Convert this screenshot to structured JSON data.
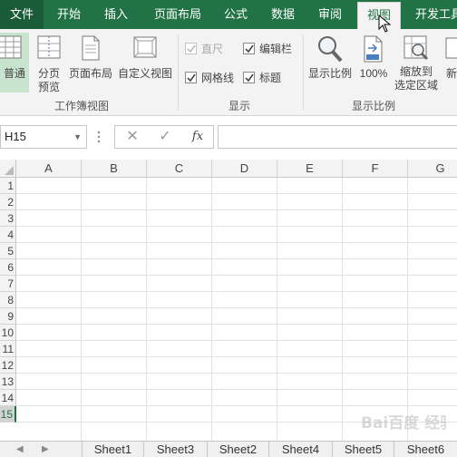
{
  "tabs": [
    {
      "label": "文件"
    },
    {
      "label": "开始"
    },
    {
      "label": "插入"
    },
    {
      "label": "页面布局"
    },
    {
      "label": "公式"
    },
    {
      "label": "数据"
    },
    {
      "label": "审阅"
    },
    {
      "label": "视图"
    },
    {
      "label": "开发工具"
    }
  ],
  "active_tab": "视图",
  "ribbon": {
    "workbook_views": {
      "label": "工作簿视图",
      "buttons": [
        {
          "label": "普通",
          "pressed": true
        },
        {
          "label1": "分页",
          "label2": "预览"
        },
        {
          "label": "页面布局"
        },
        {
          "label": "自定义视图"
        }
      ]
    },
    "show": {
      "label": "显示",
      "checkboxes": [
        {
          "label": "直尺",
          "checked": true,
          "disabled": true
        },
        {
          "label": "编辑栏",
          "checked": true
        },
        {
          "label": "网格线",
          "checked": true
        },
        {
          "label": "标题",
          "checked": true
        }
      ]
    },
    "zoom": {
      "label": "显示比例",
      "buttons": [
        {
          "label": "显示比例"
        },
        {
          "label": "100%"
        },
        {
          "label1": "缩放到",
          "label2": "选定区域"
        },
        {
          "label": "新"
        }
      ]
    }
  },
  "formula_bar": {
    "name_box": "H15",
    "cancel_glyph": "✕",
    "enter_glyph": "✓",
    "fx_label": "fx",
    "formula": ""
  },
  "grid": {
    "columns": [
      "A",
      "B",
      "C",
      "D",
      "E",
      "F",
      "G"
    ],
    "rows": [
      "1",
      "2",
      "3",
      "4",
      "5",
      "6",
      "7",
      "8",
      "9",
      "10",
      "11",
      "12",
      "13",
      "14",
      "15"
    ],
    "selected_row": "15"
  },
  "sheets": [
    "Sheet1",
    "Sheet3",
    "Sheet2",
    "Sheet4",
    "Sheet5",
    "Sheet6"
  ],
  "sheet_nav": {
    "prev": "◀",
    "next": "▶"
  },
  "colors": {
    "accent": "#217346",
    "ribbon_bg": "#f3f3f3",
    "pressed": "#c8e4cf"
  },
  "watermark": {
    "text": "Bai百度 经验"
  }
}
